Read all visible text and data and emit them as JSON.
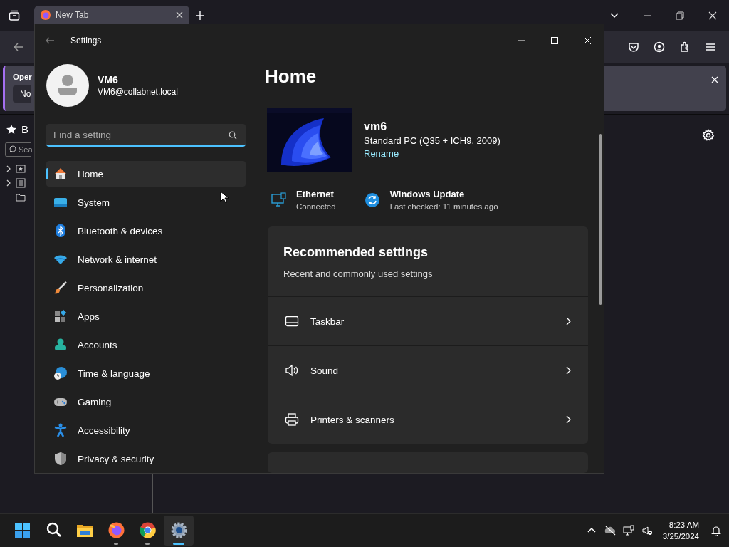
{
  "browser": {
    "tab": {
      "title": "New Tab"
    },
    "notification": {
      "title": "Oper",
      "button": "No"
    },
    "sidebar": {
      "title": "B",
      "search_placeholder": "Sea"
    }
  },
  "settings": {
    "title": "Settings",
    "user": {
      "name": "VM6",
      "email": "VM6@collabnet.local"
    },
    "search": {
      "placeholder": "Find a setting"
    },
    "nav": [
      {
        "kind": "home",
        "label": "Home",
        "selected": true
      },
      {
        "kind": "system",
        "label": "System",
        "selected": false
      },
      {
        "kind": "bluetooth",
        "label": "Bluetooth & devices",
        "selected": false
      },
      {
        "kind": "network",
        "label": "Network & internet",
        "selected": false
      },
      {
        "kind": "personalization",
        "label": "Personalization",
        "selected": false
      },
      {
        "kind": "apps",
        "label": "Apps",
        "selected": false
      },
      {
        "kind": "accounts",
        "label": "Accounts",
        "selected": false
      },
      {
        "kind": "time",
        "label": "Time & language",
        "selected": false
      },
      {
        "kind": "gaming",
        "label": "Gaming",
        "selected": false
      },
      {
        "kind": "accessibility",
        "label": "Accessibility",
        "selected": false
      },
      {
        "kind": "privacy",
        "label": "Privacy & security",
        "selected": false
      }
    ],
    "page_title": "Home",
    "device": {
      "name": "vm6",
      "model": "Standard PC (Q35 + ICH9, 2009)",
      "rename": "Rename"
    },
    "status": [
      {
        "kind": "ethernet",
        "title": "Ethernet",
        "detail": "Connected"
      },
      {
        "kind": "update",
        "title": "Windows Update",
        "detail": "Last checked: 11 minutes ago"
      }
    ],
    "recommended": {
      "title": "Recommended settings",
      "subtitle": "Recent and commonly used settings",
      "items": [
        {
          "kind": "taskbar",
          "label": "Taskbar"
        },
        {
          "kind": "sound",
          "label": "Sound"
        },
        {
          "kind": "printer",
          "label": "Printers & scanners"
        }
      ]
    }
  },
  "taskbar": {
    "apps": [
      {
        "kind": "start",
        "running": false,
        "selected": false
      },
      {
        "kind": "search",
        "running": false,
        "selected": false
      },
      {
        "kind": "explorer",
        "running": false,
        "selected": false
      },
      {
        "kind": "firefox",
        "running": true,
        "selected": false
      },
      {
        "kind": "chrome",
        "running": true,
        "selected": false
      },
      {
        "kind": "settings",
        "running": true,
        "selected": true
      }
    ],
    "clock": {
      "time": "8:23 AM",
      "date": "3/25/2024"
    }
  }
}
